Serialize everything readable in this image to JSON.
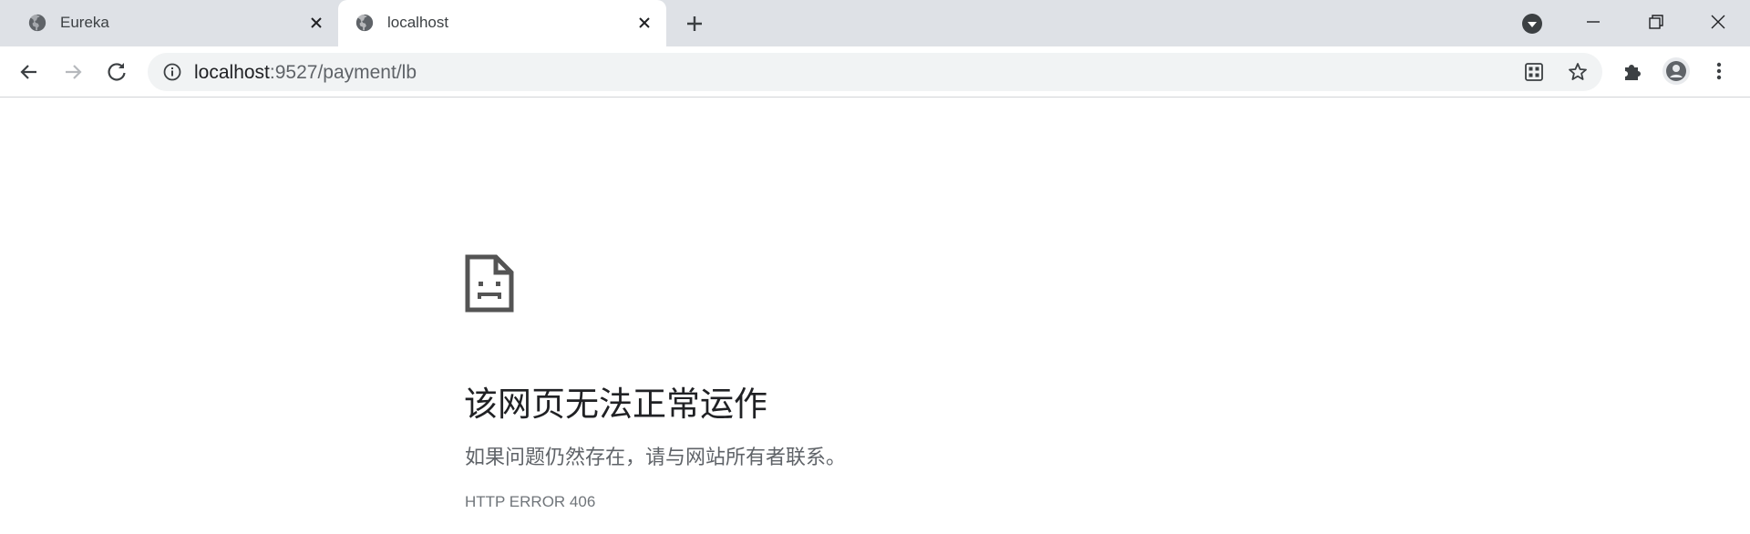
{
  "tabs": [
    {
      "title": "Eureka",
      "icon": "globe-icon",
      "active": false
    },
    {
      "title": "localhost",
      "icon": "globe-icon",
      "active": true
    }
  ],
  "toolbar": {
    "url_host": "localhost",
    "url_path": ":9527/payment/lb"
  },
  "error_page": {
    "title": "该网页无法正常运作",
    "subtitle": "如果问题仍然存在，请与网站所有者联系。",
    "code": "HTTP ERROR 406"
  },
  "colors": {
    "tabstrip_bg": "#dee1e6",
    "omnibox_bg": "#f1f3f4",
    "icon_gray": "#5f6368",
    "error_icon": "#545454"
  }
}
